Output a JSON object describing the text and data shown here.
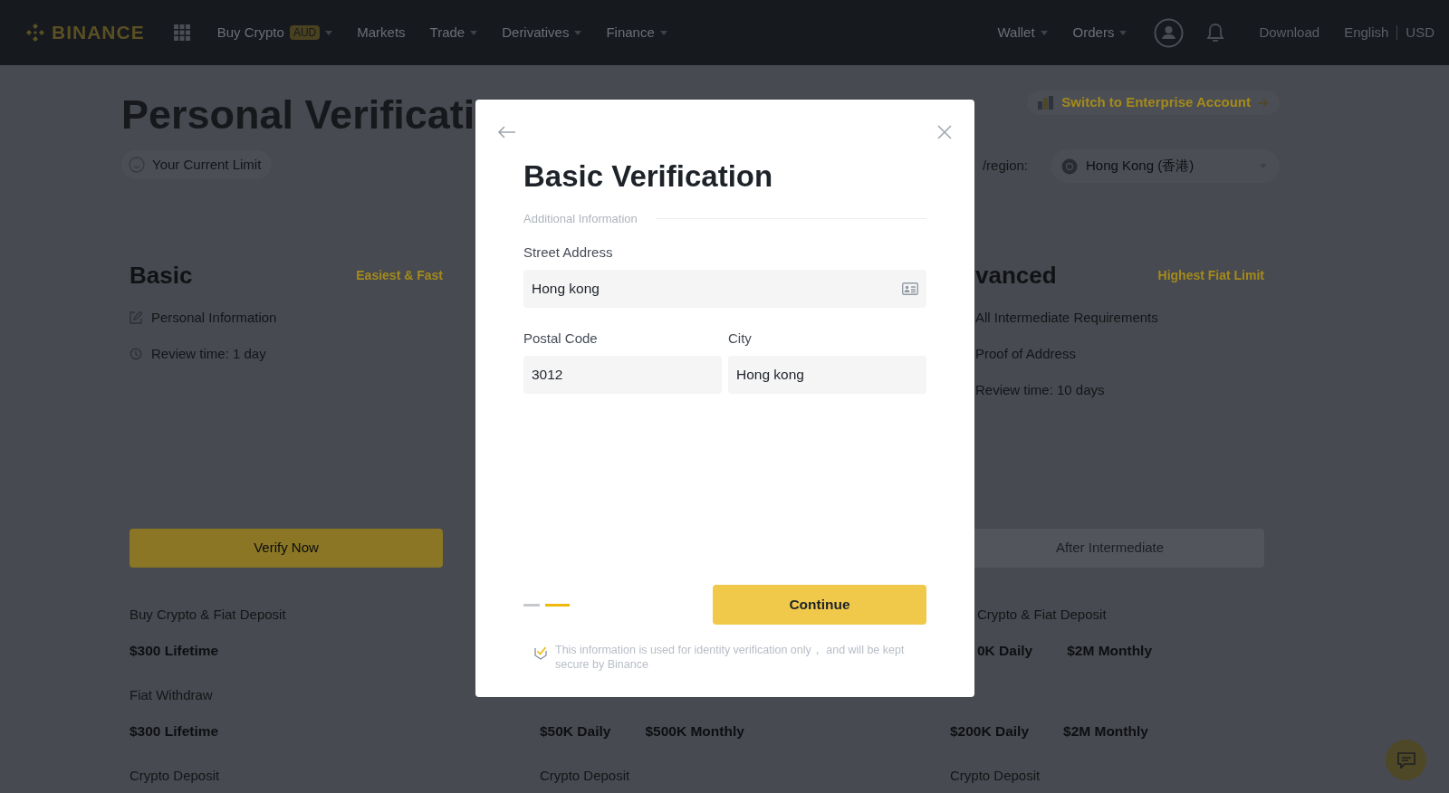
{
  "nav": {
    "logo": "BINANCE",
    "menu": [
      {
        "label": "Buy Crypto",
        "badge": "AUD",
        "dropdown": true
      },
      {
        "label": "Markets",
        "dropdown": false
      },
      {
        "label": "Trade",
        "dropdown": true
      },
      {
        "label": "Derivatives",
        "dropdown": true
      },
      {
        "label": "Finance",
        "dropdown": true
      }
    ],
    "right_menu": [
      {
        "label": "Wallet",
        "dropdown": true
      },
      {
        "label": "Orders",
        "dropdown": true
      }
    ],
    "download": "Download",
    "language": "English",
    "currency": "USD"
  },
  "page": {
    "title": "Personal Verificati",
    "current_limit": "Your Current Limit",
    "enterprise_link": "Switch to Enterprise Account",
    "region": {
      "label": "/region:",
      "value": "Hong Kong (香港)"
    },
    "left_tier": {
      "title": "Basic",
      "tag": "Easiest & Fast",
      "requirements": [
        {
          "kind": "edit",
          "text": "Personal Information"
        },
        {
          "kind": "clock",
          "text": "Review time: 1 day"
        }
      ],
      "button": {
        "label": "Verify Now",
        "disabled": false
      }
    },
    "right_tier": {
      "title": "vanced",
      "tag": "Highest Fiat Limit",
      "requirements": [
        {
          "text": "All Intermediate Requirements"
        },
        {
          "text": "Proof of Address"
        },
        {
          "text": "Review time: 10 days"
        }
      ],
      "button": {
        "label": "After Intermediate",
        "disabled": true
      }
    },
    "limit_rows": [
      {
        "cells": [
          {
            "label": "Buy Crypto & Fiat Deposit",
            "values": [
              "$300 Lifetime"
            ]
          },
          null,
          {
            "label": "Crypto & Fiat Deposit",
            "values": [
              "0K Daily",
              "$2M Monthly"
            ],
            "covered": true
          }
        ]
      },
      {
        "cells": [
          {
            "label": "Fiat Withdraw",
            "values": [
              "$300 Lifetime"
            ]
          },
          {
            "values": [
              "$50K Daily",
              "$500K Monthly"
            ]
          },
          {
            "values": [
              "$200K Daily",
              "$2M Monthly"
            ]
          }
        ]
      },
      {
        "cells": [
          {
            "label": "Crypto Deposit"
          },
          {
            "label": "Crypto Deposit"
          },
          {
            "label": "Crypto Deposit"
          }
        ]
      }
    ]
  },
  "modal": {
    "title": "Basic Verification",
    "section": "Additional Information",
    "fields": [
      {
        "label": "Street Address",
        "value": "Hong kong",
        "kind": "address"
      },
      {
        "label": "Postal Code",
        "value": "3012",
        "kind": "half"
      },
      {
        "label": "City",
        "value": "Hong kong",
        "kind": "half"
      }
    ],
    "steps": [
      {
        "selected": false
      },
      {
        "selected": true
      }
    ],
    "continue": "Continue",
    "notice": "This information is used for identity verification only， and will be kept secure by Binance"
  }
}
